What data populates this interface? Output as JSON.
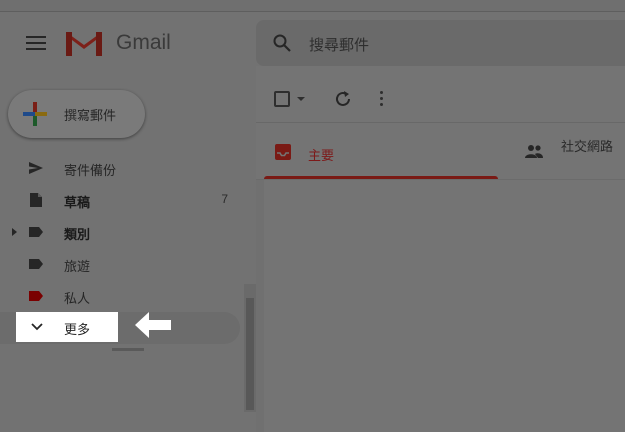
{
  "app": {
    "name": "Gmail"
  },
  "search": {
    "placeholder": "搜尋郵件"
  },
  "compose": {
    "label": "撰寫郵件"
  },
  "sidebar": {
    "items": [
      {
        "label": "寄件備份",
        "icon": "send-icon",
        "bold": false,
        "count": ""
      },
      {
        "label": "草稿",
        "icon": "draft-icon",
        "bold": true,
        "count": "7"
      },
      {
        "label": "類別",
        "icon": "label-icon",
        "bold": true,
        "count": ""
      },
      {
        "label": "旅遊",
        "icon": "label-icon",
        "bold": false,
        "count": ""
      },
      {
        "label": "私人",
        "icon": "label-icon",
        "bold": false,
        "count": "",
        "color": "#7a0000"
      }
    ],
    "more_label": "更多"
  },
  "tabs": {
    "primary": {
      "label": "主要"
    },
    "social": {
      "label": "社交網路"
    }
  },
  "colors": {
    "accent": "#7a1a15",
    "highlight": "#ffffff",
    "overlay": "#727272"
  }
}
